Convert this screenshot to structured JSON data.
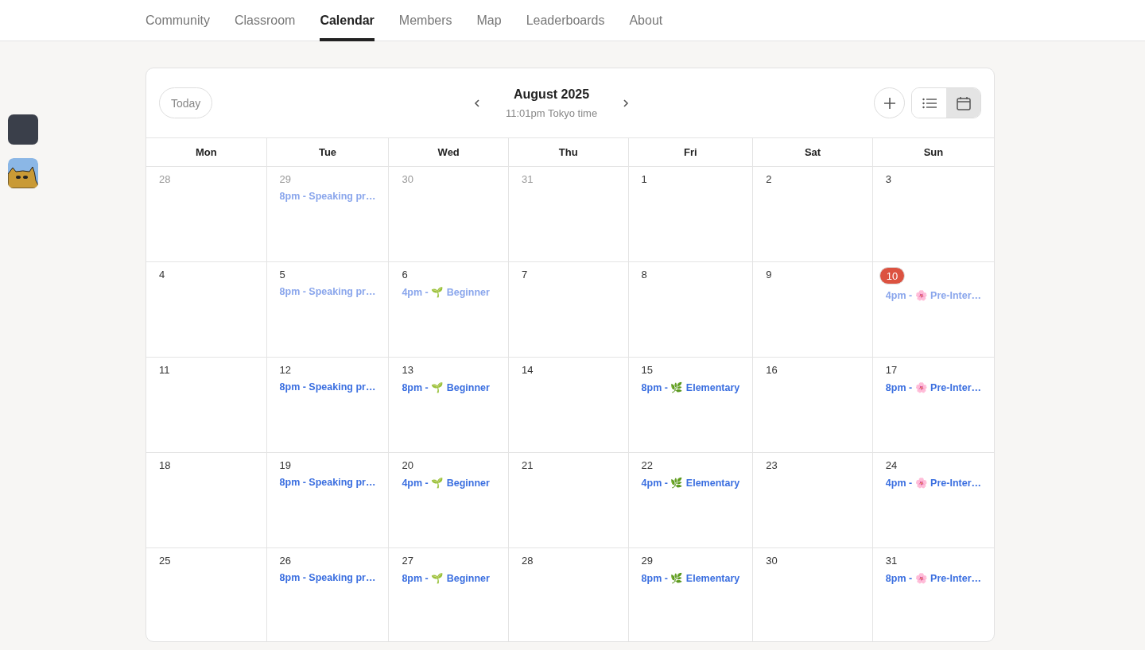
{
  "nav": {
    "tabs": [
      {
        "label": "Community",
        "selected": false
      },
      {
        "label": "Classroom",
        "selected": false
      },
      {
        "label": "Calendar",
        "selected": true
      },
      {
        "label": "Members",
        "selected": false
      },
      {
        "label": "Map",
        "selected": false
      },
      {
        "label": "Leaderboards",
        "selected": false
      },
      {
        "label": "About",
        "selected": false
      }
    ]
  },
  "sidebar": {
    "avatars": [
      {
        "kind": "photo"
      },
      {
        "kind": "cat"
      }
    ]
  },
  "calendar": {
    "today_button": "Today",
    "month": "August 2025",
    "local_time": "11:01pm Tokyo time",
    "views": [
      {
        "kind": "list",
        "selected": false
      },
      {
        "kind": "month",
        "selected": true
      }
    ],
    "weekdays": [
      "Mon",
      "Tue",
      "Wed",
      "Thu",
      "Fri",
      "Sat",
      "Sun"
    ],
    "weeks": [
      [
        {
          "day": "28",
          "other_month": true,
          "today": false
        },
        {
          "day": "29",
          "other_month": true,
          "today": false,
          "events": [
            {
              "text": "8pm - Speaking pr…",
              "past": true
            }
          ]
        },
        {
          "day": "30",
          "other_month": true,
          "today": false
        },
        {
          "day": "31",
          "other_month": true,
          "today": false
        },
        {
          "day": "1",
          "other_month": false,
          "today": false
        },
        {
          "day": "2",
          "other_month": false,
          "today": false
        },
        {
          "day": "3",
          "other_month": false,
          "today": false
        }
      ],
      [
        {
          "day": "4",
          "other_month": false,
          "today": false
        },
        {
          "day": "5",
          "other_month": false,
          "today": false,
          "events": [
            {
              "text": "8pm - Speaking pr…",
              "past": true
            }
          ]
        },
        {
          "day": "6",
          "other_month": false,
          "today": false,
          "events": [
            {
              "text": "4pm - 🌱 Beginner",
              "past": true
            }
          ]
        },
        {
          "day": "7",
          "other_month": false,
          "today": false
        },
        {
          "day": "8",
          "other_month": false,
          "today": false
        },
        {
          "day": "9",
          "other_month": false,
          "today": false
        },
        {
          "day": "10",
          "other_month": false,
          "today": true,
          "events": [
            {
              "text": "4pm - 🌸 Pre-Inter…",
              "past": true
            }
          ]
        }
      ],
      [
        {
          "day": "11",
          "other_month": false,
          "today": false
        },
        {
          "day": "12",
          "other_month": false,
          "today": false,
          "events": [
            {
              "text": "8pm - Speaking pr…",
              "past": false
            }
          ]
        },
        {
          "day": "13",
          "other_month": false,
          "today": false,
          "events": [
            {
              "text": "8pm - 🌱 Beginner",
              "past": false
            }
          ]
        },
        {
          "day": "14",
          "other_month": false,
          "today": false
        },
        {
          "day": "15",
          "other_month": false,
          "today": false,
          "events": [
            {
              "text": "8pm - 🌿 Elementary",
              "past": false
            }
          ]
        },
        {
          "day": "16",
          "other_month": false,
          "today": false
        },
        {
          "day": "17",
          "other_month": false,
          "today": false,
          "events": [
            {
              "text": "8pm - 🌸 Pre-Inter…",
              "past": false
            }
          ]
        }
      ],
      [
        {
          "day": "18",
          "other_month": false,
          "today": false
        },
        {
          "day": "19",
          "other_month": false,
          "today": false,
          "events": [
            {
              "text": "8pm - Speaking pr…",
              "past": false
            }
          ]
        },
        {
          "day": "20",
          "other_month": false,
          "today": false,
          "events": [
            {
              "text": "4pm - 🌱 Beginner",
              "past": false
            }
          ]
        },
        {
          "day": "21",
          "other_month": false,
          "today": false
        },
        {
          "day": "22",
          "other_month": false,
          "today": false,
          "events": [
            {
              "text": "4pm - 🌿 Elementary",
              "past": false
            }
          ]
        },
        {
          "day": "23",
          "other_month": false,
          "today": false
        },
        {
          "day": "24",
          "other_month": false,
          "today": false,
          "events": [
            {
              "text": "4pm - 🌸 Pre-Inter…",
              "past": false
            }
          ]
        }
      ],
      [
        {
          "day": "25",
          "other_month": false,
          "today": false
        },
        {
          "day": "26",
          "other_month": false,
          "today": false,
          "events": [
            {
              "text": "8pm - Speaking pr…",
              "past": false
            }
          ]
        },
        {
          "day": "27",
          "other_month": false,
          "today": false,
          "events": [
            {
              "text": "8pm - 🌱 Beginner",
              "past": false
            }
          ]
        },
        {
          "day": "28",
          "other_month": false,
          "today": false
        },
        {
          "day": "29",
          "other_month": false,
          "today": false,
          "events": [
            {
              "text": "8pm - 🌿 Elementary",
              "past": false
            }
          ]
        },
        {
          "day": "30",
          "other_month": false,
          "today": false
        },
        {
          "day": "31",
          "other_month": false,
          "today": false,
          "events": [
            {
              "text": "8pm - 🌸 Pre-Inter…",
              "past": false
            }
          ]
        }
      ]
    ]
  }
}
